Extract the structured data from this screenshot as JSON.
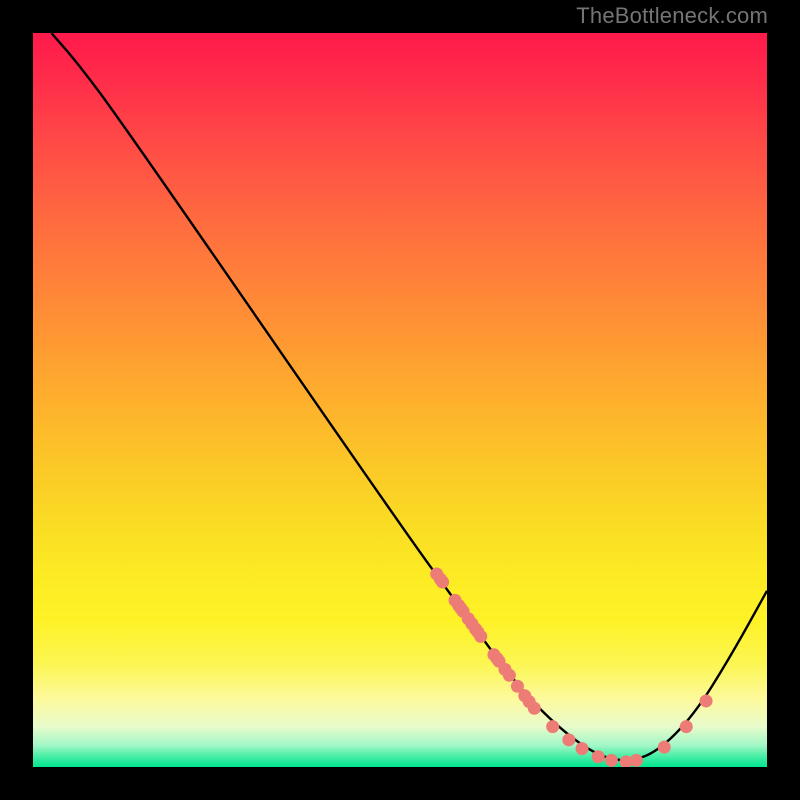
{
  "attribution": "TheBottleneck.com",
  "chart_data": {
    "type": "line",
    "title": "",
    "xlabel": "",
    "ylabel": "",
    "xlim": [
      0,
      100
    ],
    "ylim": [
      0,
      100
    ],
    "curve": [
      {
        "x": 2.5,
        "y": 100
      },
      {
        "x": 6,
        "y": 96
      },
      {
        "x": 12,
        "y": 88
      },
      {
        "x": 50,
        "y": 33
      },
      {
        "x": 58,
        "y": 22
      },
      {
        "x": 66,
        "y": 11
      },
      {
        "x": 72,
        "y": 5
      },
      {
        "x": 77,
        "y": 1.5
      },
      {
        "x": 81,
        "y": 0.7
      },
      {
        "x": 85,
        "y": 2
      },
      {
        "x": 90,
        "y": 7
      },
      {
        "x": 95,
        "y": 15
      },
      {
        "x": 100,
        "y": 24
      }
    ],
    "markers": [
      {
        "x": 55,
        "y": 26.3
      },
      {
        "x": 55.5,
        "y": 25.6
      },
      {
        "x": 55.8,
        "y": 25.2
      },
      {
        "x": 57.5,
        "y": 22.7
      },
      {
        "x": 58,
        "y": 22.0
      },
      {
        "x": 58.3,
        "y": 21.6
      },
      {
        "x": 58.6,
        "y": 21.2
      },
      {
        "x": 59.3,
        "y": 20.2
      },
      {
        "x": 59.8,
        "y": 19.5
      },
      {
        "x": 60.3,
        "y": 18.8
      },
      {
        "x": 60.6,
        "y": 18.4
      },
      {
        "x": 61.0,
        "y": 17.8
      },
      {
        "x": 62.8,
        "y": 15.3
      },
      {
        "x": 63.2,
        "y": 14.8
      },
      {
        "x": 63.5,
        "y": 14.4
      },
      {
        "x": 64.3,
        "y": 13.3
      },
      {
        "x": 64.9,
        "y": 12.5
      },
      {
        "x": 66.0,
        "y": 11.0
      },
      {
        "x": 67.0,
        "y": 9.7
      },
      {
        "x": 67.6,
        "y": 8.9
      },
      {
        "x": 68.3,
        "y": 8.0
      },
      {
        "x": 70.8,
        "y": 5.5
      },
      {
        "x": 73.0,
        "y": 3.7
      },
      {
        "x": 74.8,
        "y": 2.5
      },
      {
        "x": 77.0,
        "y": 1.4
      },
      {
        "x": 78.8,
        "y": 0.9
      },
      {
        "x": 80.8,
        "y": 0.7
      },
      {
        "x": 82.2,
        "y": 0.9
      },
      {
        "x": 86.0,
        "y": 2.7
      },
      {
        "x": 89.0,
        "y": 5.5
      },
      {
        "x": 91.7,
        "y": 9.0
      }
    ],
    "marker_color": "#ed7b76",
    "curve_color": "#000000"
  }
}
